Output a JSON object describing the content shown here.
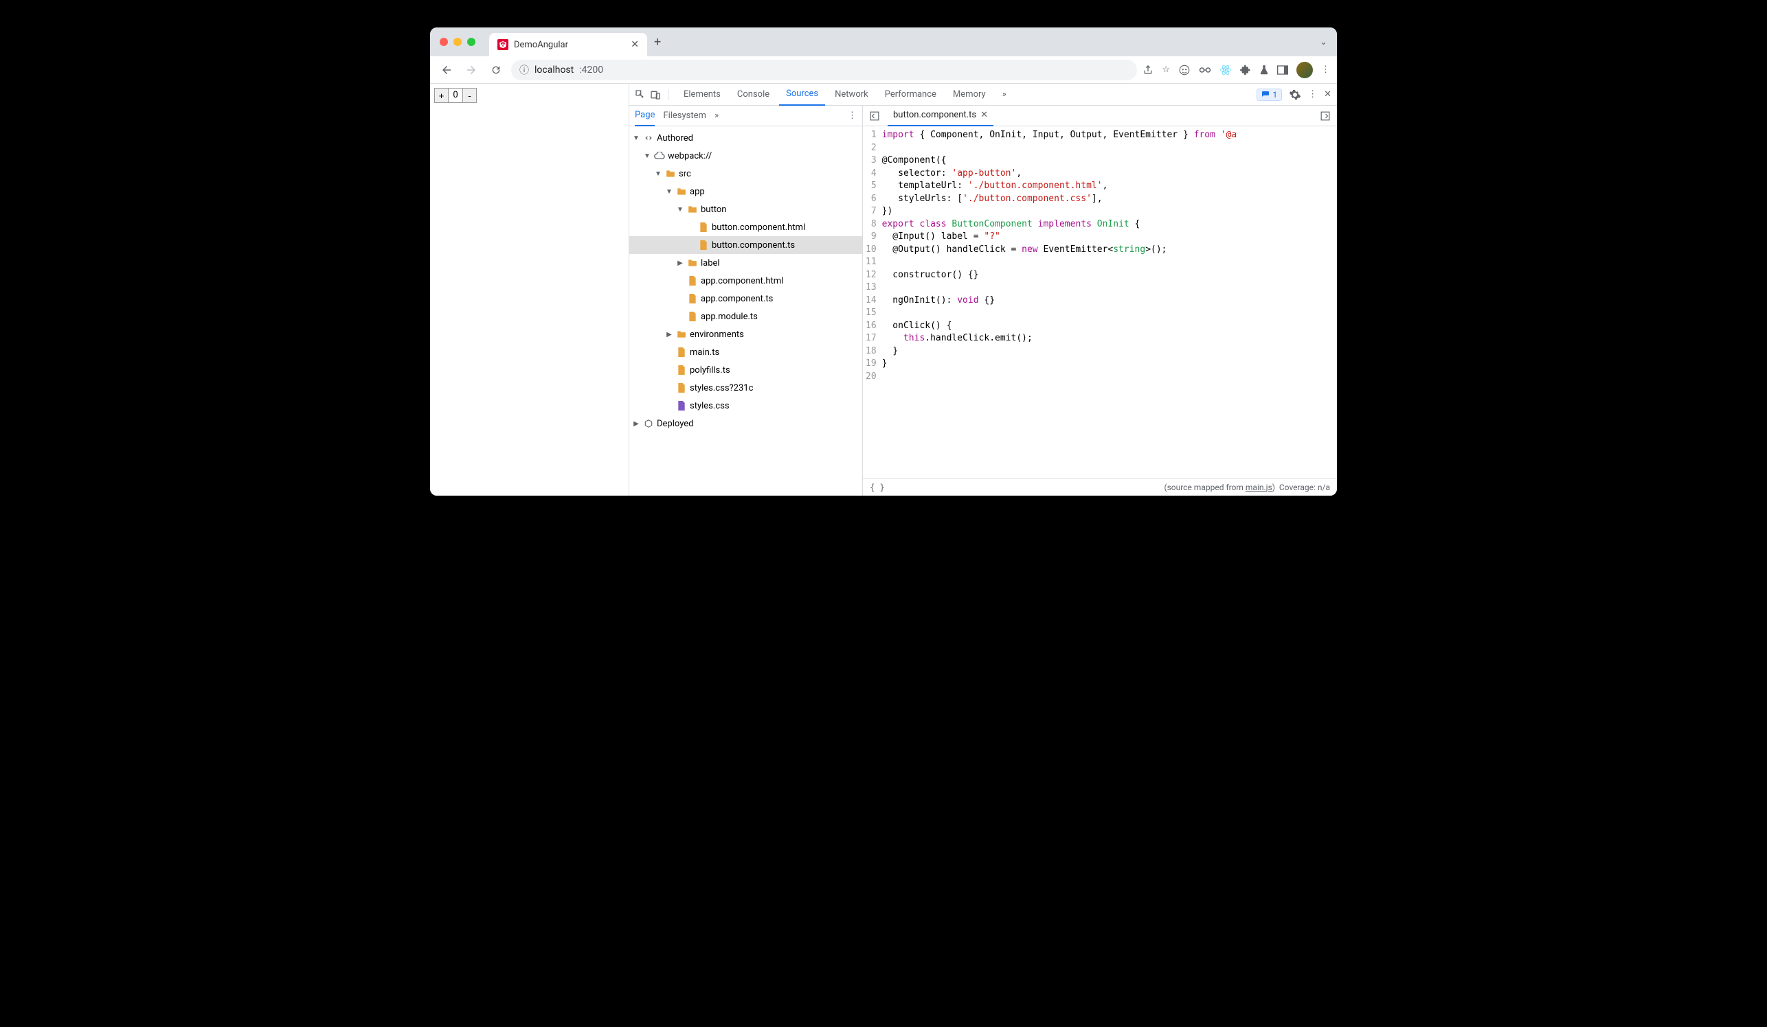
{
  "browser": {
    "tab_title": "DemoAngular",
    "url_host": "localhost",
    "url_port": ":4200"
  },
  "page": {
    "counter_value": "0"
  },
  "devtools": {
    "tabs": [
      "Elements",
      "Console",
      "Sources",
      "Network",
      "Performance",
      "Memory"
    ],
    "active_tab": "Sources",
    "issue_count": "1",
    "nav_subtabs": [
      "Page",
      "Filesystem"
    ],
    "active_subtab": "Page",
    "tree": {
      "authored": "Authored",
      "webpack": "webpack://",
      "src": "src",
      "app": "app",
      "button": "button",
      "button_html": "button.component.html",
      "button_ts": "button.component.ts",
      "label": "label",
      "app_html": "app.component.html",
      "app_ts": "app.component.ts",
      "app_module": "app.module.ts",
      "environments": "environments",
      "main_ts": "main.ts",
      "polyfills": "polyfills.ts",
      "styles_q": "styles.css?231c",
      "styles": "styles.css",
      "deployed": "Deployed"
    },
    "open_file": "button.component.ts",
    "code_lines": [
      [
        [
          "kw",
          "import"
        ],
        [
          "",
          " { Component, OnInit, Input, Output, EventEmitter } "
        ],
        [
          "kw",
          "from"
        ],
        [
          "",
          " "
        ],
        [
          "str",
          "'@a"
        ]
      ],
      [],
      [
        [
          "",
          "@Component({"
        ]
      ],
      [
        [
          "",
          "   selector: "
        ],
        [
          "str",
          "'app-button'"
        ],
        [
          "",
          ","
        ]
      ],
      [
        [
          "",
          "   templateUrl: "
        ],
        [
          "str",
          "'./button.component.html'"
        ],
        [
          "",
          ","
        ]
      ],
      [
        [
          "",
          "   styleUrls: ["
        ],
        [
          "str",
          "'./button.component.css'"
        ],
        [
          "",
          "],"
        ]
      ],
      [
        [
          "",
          "})"
        ]
      ],
      [
        [
          "kw",
          "export"
        ],
        [
          "",
          " "
        ],
        [
          "kw",
          "class"
        ],
        [
          "",
          " "
        ],
        [
          "type",
          "ButtonComponent"
        ],
        [
          "",
          " "
        ],
        [
          "kw",
          "implements"
        ],
        [
          "",
          " "
        ],
        [
          "type",
          "OnInit"
        ],
        [
          "",
          " {"
        ]
      ],
      [
        [
          "",
          "  @Input() label = "
        ],
        [
          "str",
          "\"?\""
        ]
      ],
      [
        [
          "",
          "  @Output() handleClick = "
        ],
        [
          "kw",
          "new"
        ],
        [
          "",
          " EventEmitter<"
        ],
        [
          "type",
          "string"
        ],
        [
          "",
          ">();"
        ]
      ],
      [],
      [
        [
          "",
          "  constructor() {}"
        ]
      ],
      [],
      [
        [
          "",
          "  ngOnInit(): "
        ],
        [
          "kw",
          "void"
        ],
        [
          "",
          " {}"
        ]
      ],
      [],
      [
        [
          "",
          "  onClick() {"
        ]
      ],
      [
        [
          "",
          "    "
        ],
        [
          "kw",
          "this"
        ],
        [
          "",
          ".handleClick.emit();"
        ]
      ],
      [
        [
          "",
          "  }"
        ]
      ],
      [
        [
          "",
          "}"
        ]
      ],
      []
    ],
    "status": {
      "source_mapped_prefix": "(source mapped from ",
      "source_mapped_link": "main.js",
      "source_mapped_suffix": ")",
      "coverage": "Coverage: n/a"
    }
  }
}
